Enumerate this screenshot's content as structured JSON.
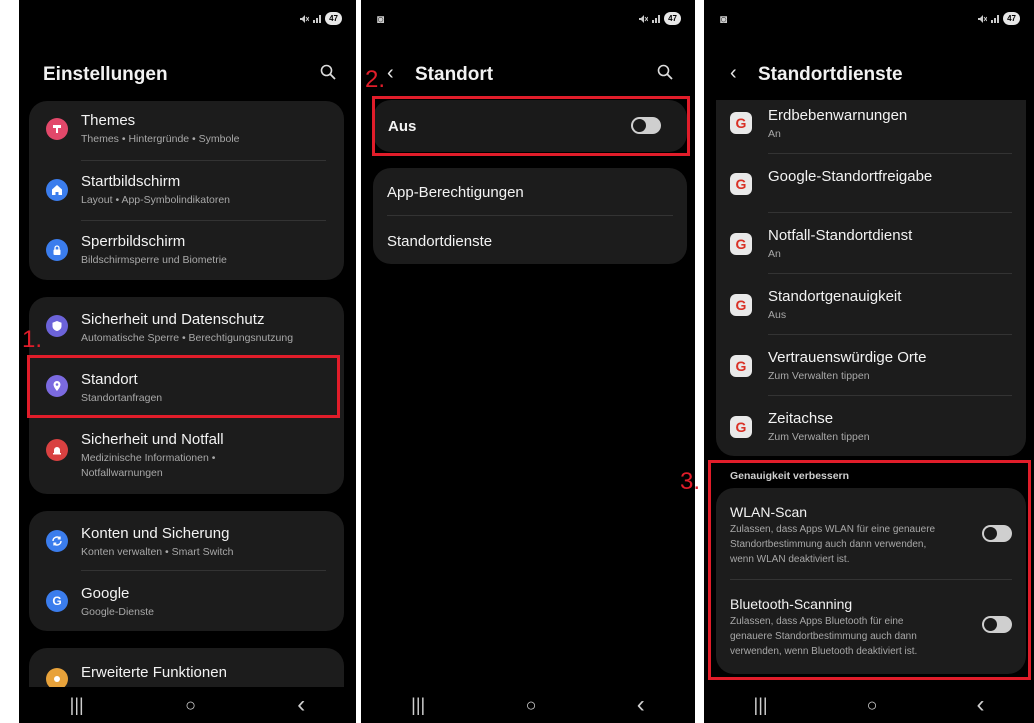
{
  "status": {
    "battery": "47"
  },
  "screen1": {
    "title": "Einstellungen",
    "group1": [
      {
        "title": "Themes",
        "sub": "Themes • Hintergründe • Symbole",
        "color": "#e2486a"
      },
      {
        "title": "Startbildschirm",
        "sub": "Layout • App-Symbolindikatoren",
        "color": "#3b7ded"
      },
      {
        "title": "Sperrbildschirm",
        "sub": "Bildschirmsperre und Biometrie",
        "color": "#3b7ded"
      }
    ],
    "group2": [
      {
        "title": "Sicherheit und Datenschutz",
        "sub": "Automatische Sperre • Berechtigungsnutzung",
        "color": "#6c63d9"
      },
      {
        "title": "Standort",
        "sub": "Standortanfragen",
        "color": "#7b6ae0"
      },
      {
        "title": "Sicherheit und Notfall",
        "sub": "Medizinische Informationen •",
        "sub2": "Notfallwarnungen",
        "color": "#d94141"
      }
    ],
    "group3": [
      {
        "title": "Konten und Sicherung",
        "sub": "Konten verwalten • Smart Switch",
        "color": "#3b7ded"
      },
      {
        "title": "Google",
        "sub": "Google-Dienste",
        "color": "#3b7ded"
      }
    ],
    "group4": [
      {
        "title": "Erweiterte Funktionen",
        "color": "#e8a23a"
      }
    ],
    "step": "1."
  },
  "screen2": {
    "title": "Standort",
    "toggle_label": "Aus",
    "items": [
      "App-Berechtigungen",
      "Standortdienste"
    ],
    "step": "2."
  },
  "screen3": {
    "title": "Standortdienste",
    "services": [
      {
        "title": "Erdbebenwarnungen",
        "sub": "An"
      },
      {
        "title": "Google-Standortfreigabe",
        "sub": ""
      },
      {
        "title": "Notfall-Standortdienst",
        "sub": "An"
      },
      {
        "title": "Standortgenauigkeit",
        "sub": "Aus"
      },
      {
        "title": "Vertrauenswürdige Orte",
        "sub": "Zum Verwalten tippen"
      },
      {
        "title": "Zeitachse",
        "sub": "Zum Verwalten tippen"
      }
    ],
    "section_header": "Genauigkeit verbessern",
    "wlan": {
      "title": "WLAN-Scan",
      "lines": [
        "Zulassen, dass Apps WLAN für eine genauere",
        "Standortbestimmung auch dann verwenden,",
        "wenn WLAN deaktiviert ist."
      ]
    },
    "bt": {
      "title": "Bluetooth-Scanning",
      "lines": [
        "Zulassen, dass Apps Bluetooth für eine",
        "genauere Standortbestimmung auch dann",
        "verwenden, wenn Bluetooth deaktiviert ist."
      ]
    },
    "step": "3."
  },
  "nav": {
    "recents": "|||",
    "home": "○",
    "back": "‹"
  },
  "icons": {
    "search": "search-icon",
    "back": "back-icon",
    "google": "G"
  }
}
